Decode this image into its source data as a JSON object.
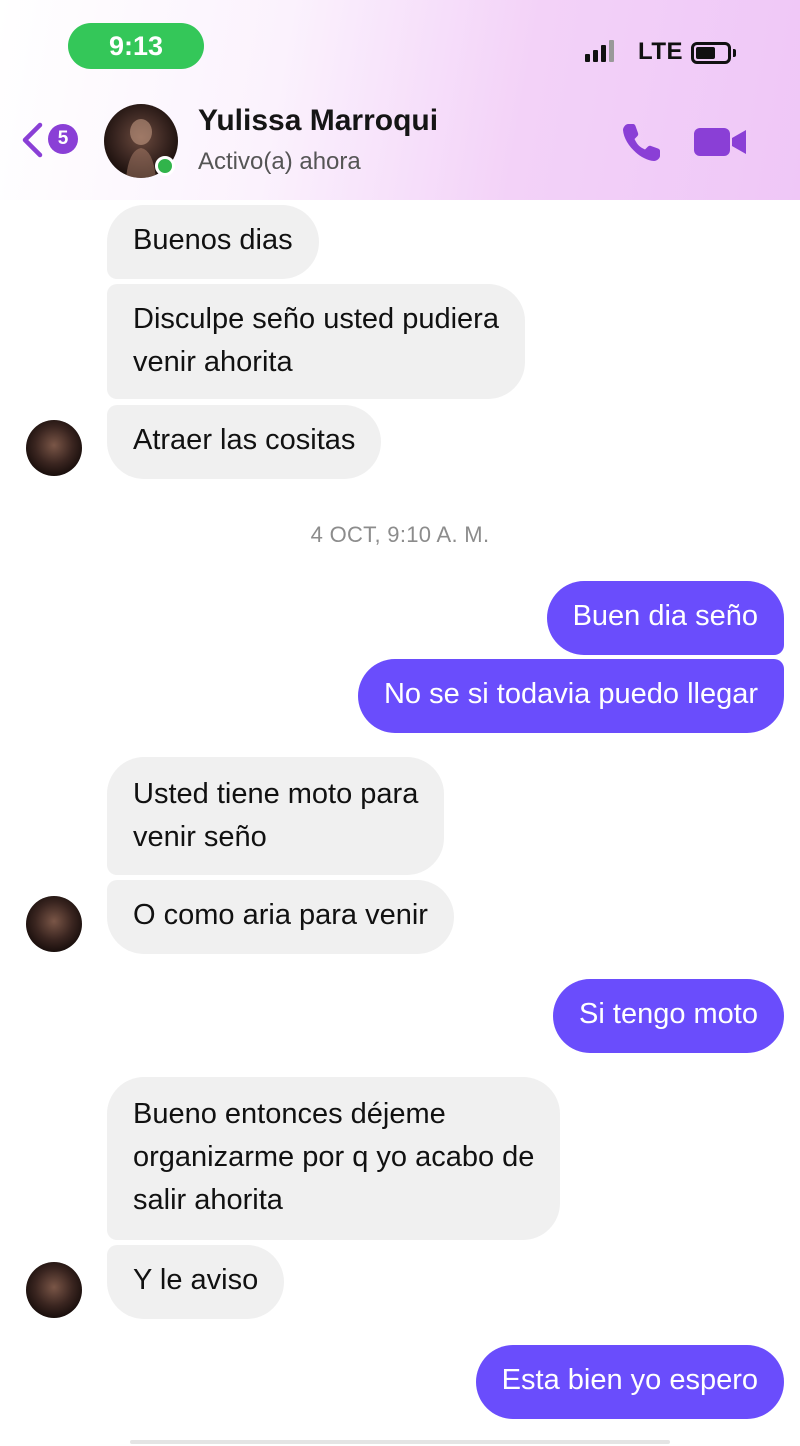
{
  "status_bar": {
    "time": "9:13",
    "network": "LTE"
  },
  "header": {
    "back_badge_count": "5",
    "contact_name": "Yulissa Marroqui",
    "contact_status": "Activo(a) ahora",
    "icons": [
      "back-chevron-icon",
      "phone-icon",
      "video-camera-icon"
    ],
    "accent_color": "#8a3fd6"
  },
  "messages": [
    {
      "dir": "in",
      "text": "Buenos dias"
    },
    {
      "dir": "in",
      "lines": [
        "Disculpe seño usted pudiera",
        "venir ahorita"
      ]
    },
    {
      "dir": "in",
      "text": "Atraer las cositas"
    },
    {
      "dir": "out",
      "text": "Buen dia seño"
    },
    {
      "dir": "out",
      "text": "No se si todavia puedo llegar"
    },
    {
      "dir": "in",
      "lines": [
        "Usted tiene moto para",
        "venir seño"
      ]
    },
    {
      "dir": "in",
      "text": "O como aria para venir"
    },
    {
      "dir": "out",
      "text": "Si tengo moto"
    },
    {
      "dir": "in",
      "lines": [
        "Bueno entonces déjeme",
        "organizarme por q yo acabo de",
        "salir ahorita"
      ]
    },
    {
      "dir": "in",
      "text": "Y le aviso"
    },
    {
      "dir": "out",
      "text": "Esta bien yo espero"
    }
  ],
  "timestamp": "4 OCT, 9:10 A. M.",
  "colors": {
    "outgoing_bubble": "#6a4dfc",
    "incoming_bubble": "#f0f0f0",
    "online_indicator": "#31b44b",
    "time_pill": "#34c759"
  }
}
